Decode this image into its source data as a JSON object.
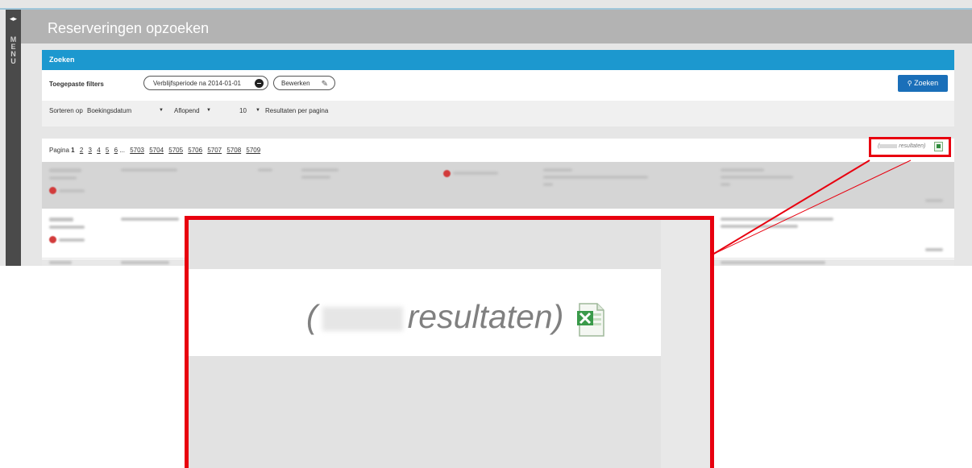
{
  "sidebar": {
    "toggle_glyph": "◂▸",
    "menu_text": "M\nE\nN\nU"
  },
  "header": {
    "title": "Reserveringen opzoeken"
  },
  "search_panel": {
    "heading": "Zoeken",
    "filters_label": "Toegepaste filters",
    "filter_chip": "Verblijfsperiode na 2014-01-01",
    "edit_button": "Bewerken",
    "search_button": "Zoeken",
    "sort_label": "Sorteren op",
    "sort_field": "Boekingsdatum",
    "sort_order": "Aflopend",
    "per_page_value": "10",
    "per_page_label": "Resultaten per pagina",
    "dropdown_glyph": "▼"
  },
  "pagination": {
    "prefix": "Pagina",
    "current": "1",
    "pages": [
      "2",
      "3",
      "4",
      "5",
      "6"
    ],
    "ellipsis": "...",
    "last_pages": [
      "5703",
      "5704",
      "5705",
      "5706",
      "5707",
      "5708",
      "5709"
    ]
  },
  "results_count": {
    "open": "(",
    "suffix": "resultaten)"
  },
  "icons": {
    "menu": "menu-toggle-icon",
    "remove": "remove-filter-icon",
    "edit": "pencil-icon",
    "search": "search-icon",
    "export": "excel-export-icon"
  },
  "colors": {
    "accent": "#1c98cf",
    "button": "#1a6fb9",
    "highlight": "#e8000f",
    "excel": "#2e8b3c"
  }
}
